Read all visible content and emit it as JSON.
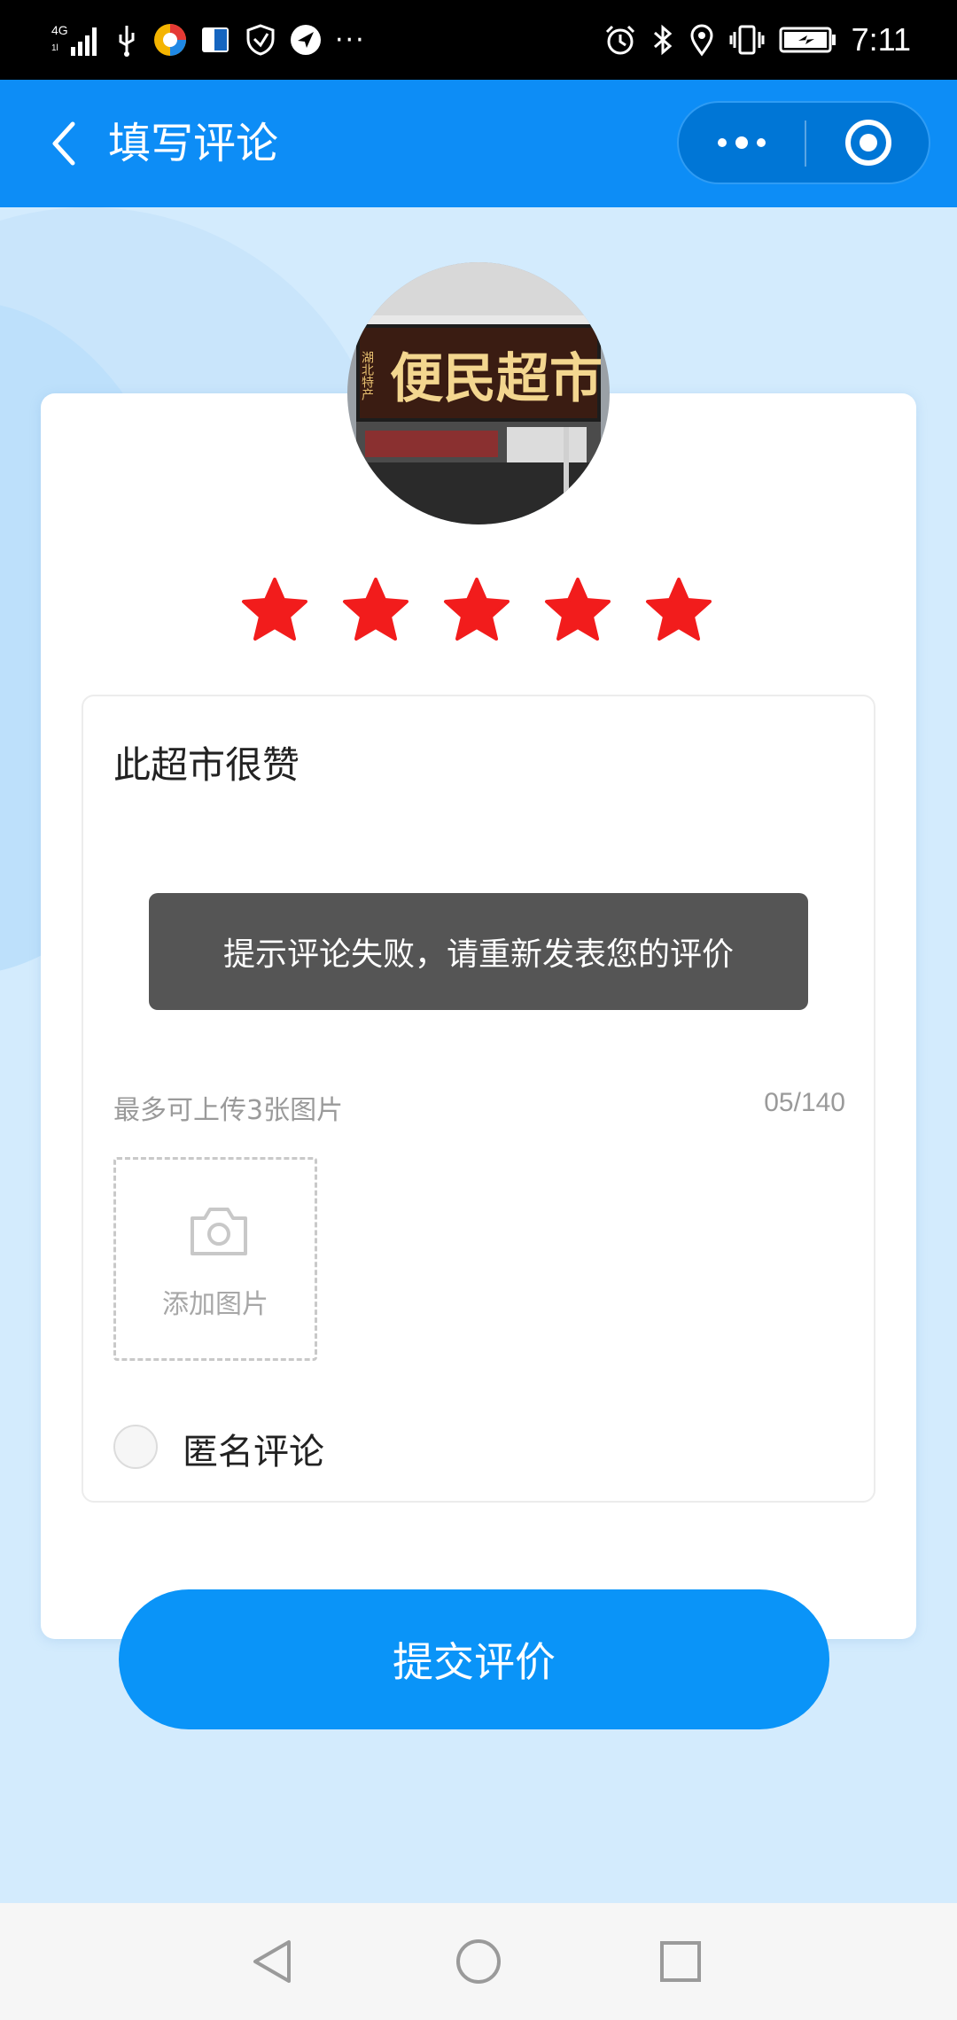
{
  "status_bar": {
    "network": "4G",
    "time": "7:11",
    "more": "···"
  },
  "header": {
    "title": "填写评论"
  },
  "store": {
    "sign_text": "便民超市",
    "sign_small": "湖北特产"
  },
  "rating": {
    "stars": 5,
    "max": 5,
    "color": "#f21c1c"
  },
  "review": {
    "text": "此超市很赞",
    "upload_hint": "最多可上传3张图片",
    "char_count": "05/140",
    "add_photo_label": "添加图片",
    "anonymous_label": "匿名评论"
  },
  "toast": {
    "message": "提示评论失败，请重新发表您的评价"
  },
  "submit": {
    "label": "提交评价"
  },
  "colors": {
    "primary": "#0d8df6",
    "button": "#0a94f8",
    "background": "#d3ebfd"
  },
  "icons": {
    "back": "chevron-left-icon",
    "more": "more-dots-icon",
    "close": "target-circle-icon",
    "camera": "camera-icon",
    "nav_back": "triangle-back-icon",
    "nav_home": "circle-home-icon",
    "nav_recent": "square-recent-icon"
  }
}
